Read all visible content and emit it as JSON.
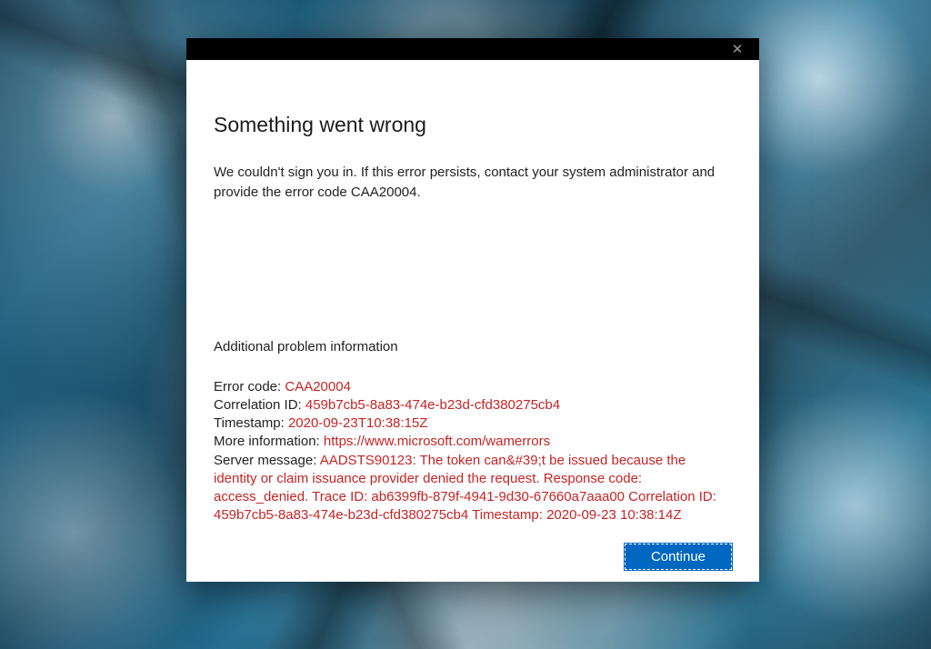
{
  "dialog": {
    "heading": "Something went wrong",
    "description": "We couldn't sign you in. If this error persists, contact your system administrator and provide the error code CAA20004.",
    "secondary_heading": "Additional problem information",
    "labels": {
      "error_code": "Error code: ",
      "correlation_id": "Correlation ID: ",
      "timestamp": "Timestamp: ",
      "more_info": "More information: ",
      "server_message": "Server message: "
    },
    "values": {
      "error_code": "CAA20004",
      "correlation_id": "459b7cb5-8a83-474e-b23d-cfd380275cb4",
      "timestamp": "2020-09-23T10:38:15Z",
      "more_info": "https://www.microsoft.com/wamerrors",
      "server_message": "AADSTS90123: The token can&#39;t be issued because the identity or claim issuance provider denied the request. Response code: access_denied. Trace ID: ab6399fb-879f-4941-9d30-67660a7aaa00 Correlation ID: 459b7cb5-8a83-474e-b23d-cfd380275cb4 Timestamp: 2020-09-23 10:38:14Z"
    },
    "continue_label": "Continue"
  }
}
